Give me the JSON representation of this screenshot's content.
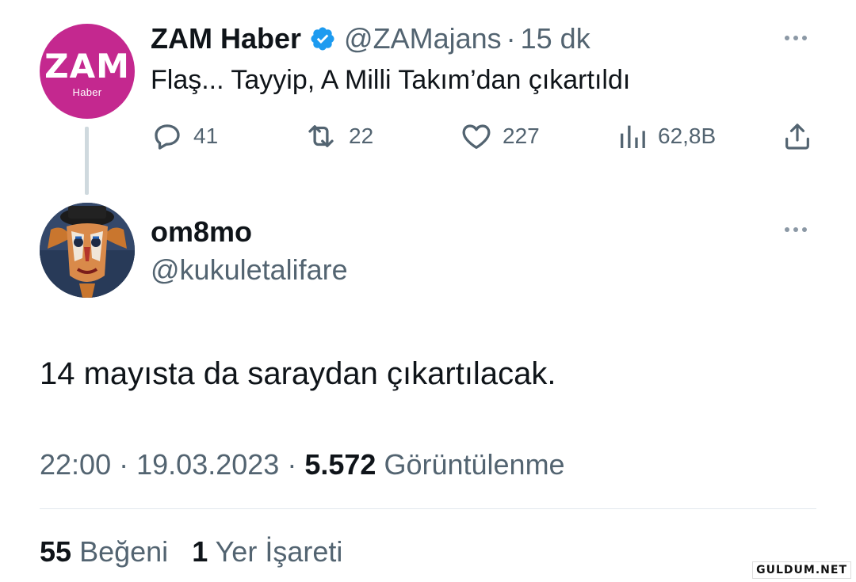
{
  "parent_tweet": {
    "avatar": {
      "logo_main": "ZAM",
      "logo_sub": "Haber",
      "color": "#c4288f"
    },
    "display_name": "ZAM Haber",
    "verified": true,
    "handle": "@ZAMajans",
    "separator": "·",
    "time": "15 dk",
    "text": "Flaş... Tayyip, A Milli Takım’dan çıkartıldı",
    "actions": {
      "replies": "41",
      "retweets": "22",
      "likes": "227",
      "views": "62,8B"
    }
  },
  "reply_tweet": {
    "avatar_icon": "clown-portrait-avatar",
    "display_name": "om8mo",
    "handle": "@kukuletalifare",
    "text": "14 mayısta da saraydan çıkartılacak.",
    "time": "22:00",
    "separator": "·",
    "date": "19.03.2023",
    "views_count": "5.572",
    "views_label": "Görüntülenme",
    "likes_count": "55",
    "likes_label": "Beğeni",
    "bookmarks_count": "1",
    "bookmarks_label": "Yer İşareti"
  },
  "watermark": "GULDUM.NET",
  "colors": {
    "text_primary": "#0f1419",
    "text_secondary": "#536471",
    "verified": "#1d9bf0",
    "divider": "#e1e8ed"
  }
}
